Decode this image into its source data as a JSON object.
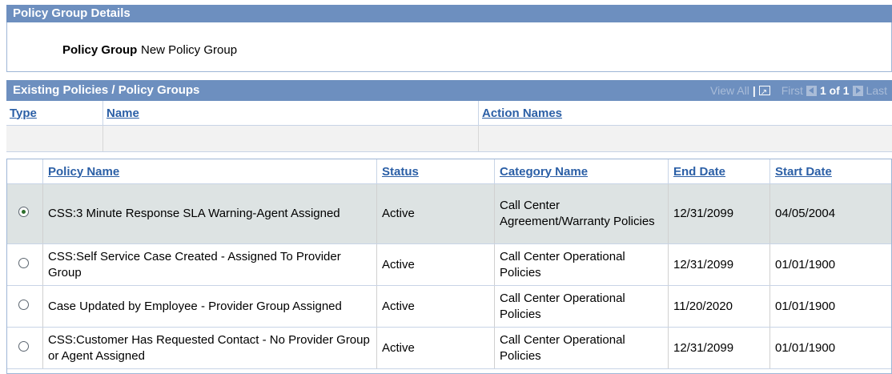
{
  "details": {
    "title": "Policy Group Details",
    "policy_group_label": "Policy Group",
    "policy_group_value": "New Policy Group"
  },
  "existing": {
    "title": "Existing Policies / Policy Groups",
    "nav": {
      "view_all": "View All",
      "separator": "|",
      "first": "First",
      "count": "1 of 1",
      "last": "Last"
    },
    "columns": [
      "Type",
      "Name",
      "Action Names"
    ]
  },
  "policies": {
    "columns": [
      "Policy Name",
      "Status",
      "Category Name",
      "End Date",
      "Start Date"
    ],
    "rows": [
      {
        "name": "CSS:3 Minute Response SLA Warning-Agent Assigned",
        "status": "Active",
        "category": "Call Center Agreement/Warranty Policies",
        "end": "12/31/2099",
        "start": "04/05/2004",
        "selected": true
      },
      {
        "name": "CSS:Self Service Case Created - Assigned To Provider Group",
        "status": "Active",
        "category": "Call Center Operational Policies",
        "end": "12/31/2099",
        "start": "01/01/1900",
        "selected": false
      },
      {
        "name": "Case Updated by Employee - Provider Group Assigned",
        "status": "Active",
        "category": "Call Center Operational Policies",
        "end": "11/20/2020",
        "start": "01/01/1900",
        "selected": false
      },
      {
        "name": "CSS:Customer Has Requested Contact - No Provider Group or Agent Assigned",
        "status": "Active",
        "category": "Call Center Operational Policies",
        "end": "12/31/2099",
        "start": "01/01/1900",
        "selected": false
      }
    ]
  },
  "colors": {
    "header_bar": "#6d8fbf",
    "link": "#2b5fa6",
    "selected_row": "#dde3e3"
  }
}
